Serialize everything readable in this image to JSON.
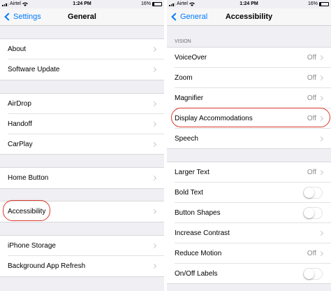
{
  "left_screen": {
    "status": {
      "carrier": "Airtel",
      "time": "1:24 PM",
      "battery": "16%"
    },
    "nav": {
      "back_label": "Settings",
      "title": "General"
    },
    "rows": [
      {
        "label": "About"
      },
      {
        "label": "Software Update"
      },
      {
        "label": "AirDrop"
      },
      {
        "label": "Handoff"
      },
      {
        "label": "CarPlay"
      },
      {
        "label": "Home Button"
      },
      {
        "label": "Accessibility"
      },
      {
        "label": "iPhone Storage"
      },
      {
        "label": "Background App Refresh"
      }
    ]
  },
  "right_screen": {
    "status": {
      "carrier": "Airtel",
      "time": "1:24 PM",
      "battery": "16%"
    },
    "nav": {
      "back_label": "General",
      "title": "Accessibility"
    },
    "section_header": "VISION",
    "rows": [
      {
        "label": "VoiceOver",
        "value": "Off"
      },
      {
        "label": "Zoom",
        "value": "Off"
      },
      {
        "label": "Magnifier",
        "value": "Off"
      },
      {
        "label": "Display Accommodations",
        "value": "Off"
      },
      {
        "label": "Speech"
      },
      {
        "label": "Larger Text",
        "value": "Off"
      },
      {
        "label": "Bold Text",
        "toggle": false
      },
      {
        "label": "Button Shapes",
        "toggle": false
      },
      {
        "label": "Increase Contrast"
      },
      {
        "label": "Reduce Motion",
        "value": "Off"
      },
      {
        "label": "On/Off Labels",
        "toggle": false
      }
    ]
  },
  "colors": {
    "accent": "#007aff",
    "highlight": "#d93a2a",
    "background": "#efeff4"
  },
  "icons": [
    "signal-icon",
    "wifi-icon",
    "battery-icon",
    "chevron-left-icon",
    "chevron-right-icon"
  ]
}
